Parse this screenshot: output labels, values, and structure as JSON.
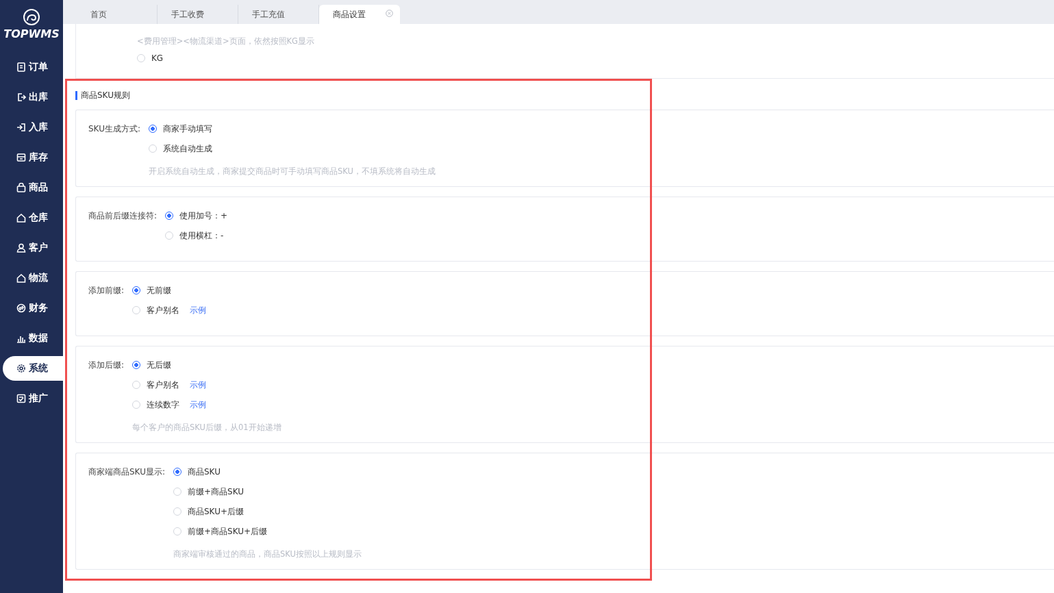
{
  "sidebar": {
    "logo": "TOPWMS",
    "items": [
      {
        "label": "订单",
        "selected": false
      },
      {
        "label": "出库",
        "selected": false
      },
      {
        "label": "入库",
        "selected": false
      },
      {
        "label": "库存",
        "selected": false
      },
      {
        "label": "商品",
        "selected": false
      },
      {
        "label": "仓库",
        "selected": false
      },
      {
        "label": "客户",
        "selected": false
      },
      {
        "label": "物流",
        "selected": false
      },
      {
        "label": "财务",
        "selected": false
      },
      {
        "label": "数据",
        "selected": false
      },
      {
        "label": "系统",
        "selected": true
      },
      {
        "label": "推广",
        "selected": false
      }
    ]
  },
  "tabs": [
    {
      "label": "首页",
      "selected": false
    },
    {
      "label": "手工收费",
      "selected": false
    },
    {
      "label": "手工充值",
      "selected": false
    },
    {
      "label": "商品设置",
      "selected": true
    }
  ],
  "top_panel": {
    "hint": "<费用管理><物流渠道>页面，依然按照KG显示",
    "options": [
      {
        "label": "KG",
        "selected": false
      }
    ]
  },
  "section": {
    "title": "商品SKU规则",
    "groups": [
      {
        "label": "SKU生成方式:",
        "options": [
          {
            "label": "商家手动填写",
            "selected": true
          },
          {
            "label": "系统自动生成",
            "selected": false
          }
        ],
        "hint": "开启系统自动生成，商家提交商品时可手动填写商品SKU，不填系统将自动生成"
      },
      {
        "label": "商品前后缀连接符:",
        "options": [
          {
            "label": "使用加号：+",
            "selected": true
          },
          {
            "label": "使用横杠：-",
            "selected": false
          }
        ]
      },
      {
        "label": "添加前缀:",
        "options": [
          {
            "label": "无前缀",
            "selected": true
          },
          {
            "label": "客户别名",
            "selected": false,
            "link": "示例"
          }
        ]
      },
      {
        "label": "添加后缀:",
        "options": [
          {
            "label": "无后缀",
            "selected": true
          },
          {
            "label": "客户别名",
            "selected": false,
            "link": "示例"
          },
          {
            "label": "连续数字",
            "selected": false,
            "link": "示例"
          }
        ],
        "hint": "每个客户的商品SKU后缀，从01开始递增"
      },
      {
        "label": "商家端商品SKU显示:",
        "options": [
          {
            "label": "商品SKU",
            "selected": true
          },
          {
            "label": "前缀+商品SKU",
            "selected": false
          },
          {
            "label": "商品SKU+后缀",
            "selected": false
          },
          {
            "label": "前缀+商品SKU+后缀",
            "selected": false
          }
        ],
        "hint": "商家端审核通过的商品，商品SKU按照以上规则显示"
      }
    ]
  }
}
